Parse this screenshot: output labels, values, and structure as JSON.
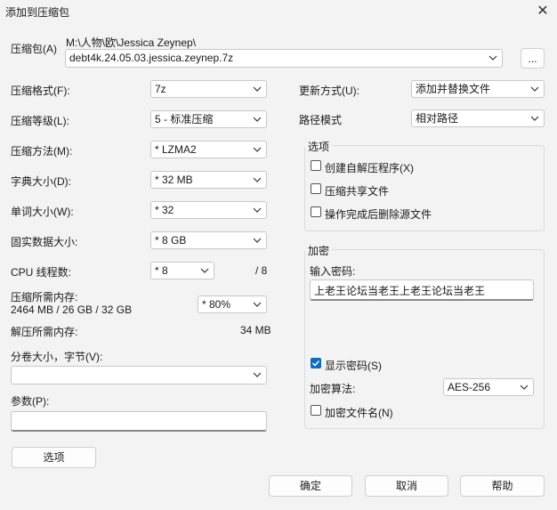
{
  "window": {
    "title": "添加到压缩包",
    "close_glyph": "✕"
  },
  "archive": {
    "label": "压缩包(A)",
    "path": "M:\\人物\\欧\\Jessica Zeynep\\",
    "filename": "debt4k.24.05.03.jessica.zeynep.7z",
    "browse_label": "..."
  },
  "left": {
    "format": {
      "label": "压缩格式(F):",
      "value": "7z"
    },
    "level": {
      "label": "压缩等级(L):",
      "value": "5 - 标准压缩"
    },
    "method": {
      "label": "压缩方法(M):",
      "value": "*  LZMA2"
    },
    "dict": {
      "label": "字典大小(D):",
      "value": "*  32 MB"
    },
    "word": {
      "label": "单词大小(W):",
      "value": "*  32"
    },
    "solid": {
      "label": "固实数据大小:",
      "value": "*  8 GB"
    },
    "threads": {
      "label": "CPU 线程数:",
      "value": "*  8",
      "max": "/ 8"
    },
    "mem_compress": {
      "label": "压缩所需内存:",
      "detail": "2464 MB / 26 GB / 32 GB",
      "value": "*  80%"
    },
    "mem_decompress": {
      "label": "解压所需内存:",
      "value": "34 MB"
    },
    "split": {
      "label": "分卷大小，字节(V):",
      "value": ""
    },
    "params": {
      "label": "参数(P):",
      "value": ""
    },
    "options_button": "选项"
  },
  "right": {
    "update": {
      "label": "更新方式(U):",
      "value": "添加并替换文件"
    },
    "pathmode": {
      "label": "路径模式",
      "value": "相对路径"
    },
    "options": {
      "title": "选项",
      "items": [
        {
          "label": "创建自解压程序(X)",
          "checked": false
        },
        {
          "label": "压缩共享文件",
          "checked": false
        },
        {
          "label": "操作完成后删除源文件",
          "checked": false
        }
      ]
    },
    "encryption": {
      "title": "加密",
      "password_label": "输入密码:",
      "password": "上老王论坛当老王上老王论坛当老王",
      "show_password": {
        "label": "显示密码(S)",
        "checked": true
      },
      "method_label": "加密算法:",
      "method": "AES-256",
      "encrypt_names": {
        "label": "加密文件名(N)",
        "checked": false
      }
    }
  },
  "buttons": {
    "ok": "确定",
    "cancel": "取消",
    "help": "帮助"
  }
}
